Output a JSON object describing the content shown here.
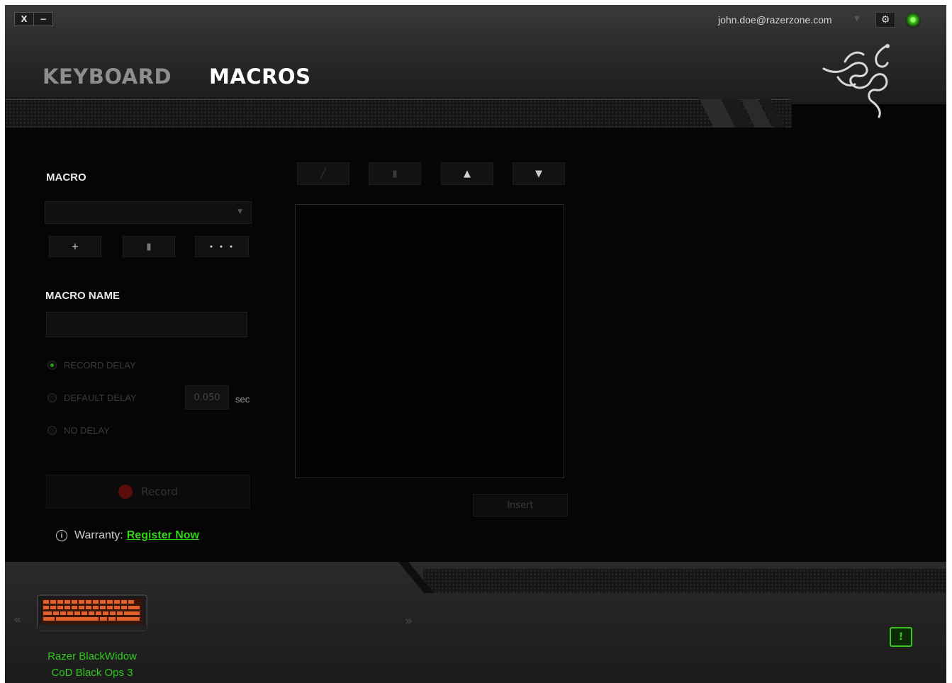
{
  "window": {
    "close_label": "X",
    "minimize_label": "−"
  },
  "header": {
    "tabs": [
      {
        "label": "KEYBOARD"
      },
      {
        "label": "MACROS"
      }
    ],
    "email": "john.doe@razerzone.com",
    "settings_icon": "gear-icon",
    "status_color": "#44d01d"
  },
  "macro": {
    "section_label": "MACRO",
    "dropdown_value": "",
    "add_label": "+",
    "more_label": "• • •",
    "name_label": "MACRO NAME",
    "name_value": ""
  },
  "delay": {
    "options": [
      "RECORD DELAY",
      "DEFAULT DELAY",
      "NO DELAY"
    ],
    "selected": "RECORD DELAY",
    "default_value": "0.050",
    "unit": "sec"
  },
  "record_label": "Record",
  "warranty": {
    "label": "Warranty:",
    "link": "Register Now"
  },
  "editor": {
    "insert_label": "Insert"
  },
  "device": {
    "name_line1": "Razer BlackWidow",
    "name_line2": "CoD Black Ops 3"
  },
  "colors": {
    "accent": "#33d11a",
    "background": "#050505"
  }
}
